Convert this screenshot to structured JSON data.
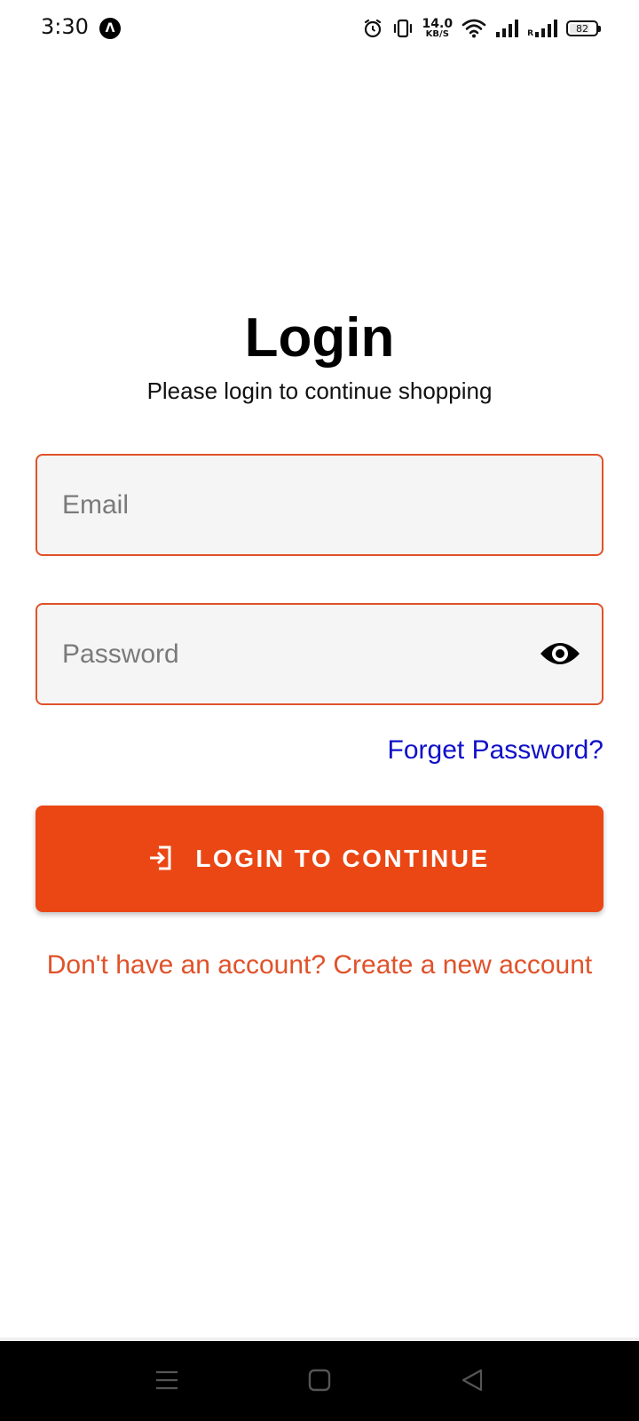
{
  "status_bar": {
    "time": "3:30",
    "app_icon": "expo-icon",
    "app_icon_glyph": "Λ",
    "icons": [
      "alarm-icon",
      "vibrate-icon",
      "wifi-icon",
      "signal-icon",
      "roaming-signal-icon"
    ],
    "net_speed_value": "14.0",
    "net_speed_unit": "KB/S",
    "roaming_label": "R",
    "battery_level": "82"
  },
  "login": {
    "title": "Login",
    "subtitle": "Please login to continue shopping",
    "email_placeholder": "Email",
    "email_value": "",
    "password_placeholder": "Password",
    "password_value": "",
    "show_password_icon": "eye-icon",
    "forgot_password": "Forget Password?",
    "button_icon": "login-icon",
    "button_label": "LOGIN TO CONTINUE",
    "signup_prompt": "Don't have an account? Create a new account"
  },
  "colors": {
    "accent": "#ea4715",
    "field_border": "#e0522a",
    "field_bg": "#f5f5f5",
    "link_blue": "#1010c8",
    "nav_bar_bg": "#000000"
  },
  "nav_bar": {
    "buttons": [
      "menu-icon",
      "home-icon",
      "back-icon"
    ]
  }
}
